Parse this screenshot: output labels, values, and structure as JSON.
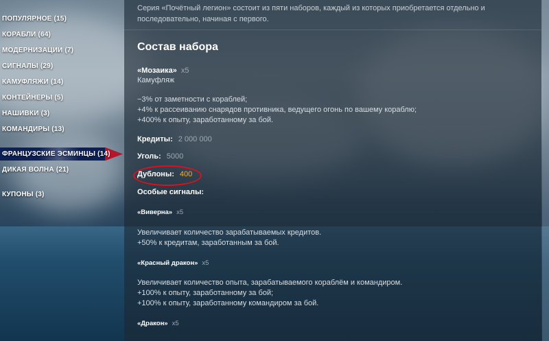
{
  "sidebar": {
    "items": [
      {
        "label": "ПОПУЛЯРНОЕ (15)"
      },
      {
        "label": "КОРАБЛИ (64)"
      },
      {
        "label": "МОДЕРНИЗАЦИИ (7)"
      },
      {
        "label": "СИГНАЛЫ (29)"
      },
      {
        "label": "КАМУФЛЯЖИ (14)"
      },
      {
        "label": "КОНТЕЙНЕРЫ (5)"
      },
      {
        "label": "НАШИВКИ (3)"
      },
      {
        "label": "КОМАНДИРЫ (13)"
      },
      {
        "label": "ФРАНЦУЗСКИЕ ЭСМИНЦЫ (14)",
        "active": true
      },
      {
        "label": "ДИКАЯ ВОЛНА (21)"
      },
      {
        "label": "КУПОНЫ (3)"
      }
    ]
  },
  "content": {
    "intro": "Серия «Почётный легион» состоит из пяти наборов, каждый из которых приобретается отдельно и последовательно, начиная с первого.",
    "section_title": "Состав набора",
    "camo": {
      "name": "«Мозаика»",
      "qty": "x5",
      "type": "Камуфляж",
      "effects": [
        "−3% от заметности с кораблей;",
        "+4% к рассеиванию снарядов противника, ведущего огонь по вашему кораблю;",
        "+400% к опыту, заработанному за бой."
      ]
    },
    "credits": {
      "label": "Кредиты:",
      "value": "2 000 000"
    },
    "coal": {
      "label": "Уголь:",
      "value": "5000"
    },
    "doubloons": {
      "label": "Дублоны:",
      "value": "400",
      "value_color": "#f2b133"
    },
    "signals_title": "Особые сигналы:",
    "signals": [
      {
        "name": "«Виверна»",
        "qty": "x5",
        "effects": [
          "Увеличивает количество зарабатываемых кредитов.",
          "+50% к кредитам, заработанным за бой."
        ]
      },
      {
        "name": "«Красный дракон»",
        "qty": "x5",
        "effects": [
          "Увеличивает количество опыта, зарабатываемого кораблём и командиром.",
          "+100% к опыту, заработанному за бой;",
          "+100% к опыту, заработанному командиром за бой."
        ]
      },
      {
        "name": "«Дракон»",
        "qty": "x5",
        "effects": []
      }
    ]
  },
  "colors": {
    "active_nav_bg": "#0c1f57",
    "active_nav_accent": "#b8152a",
    "highlight_ring": "#d8121e"
  }
}
